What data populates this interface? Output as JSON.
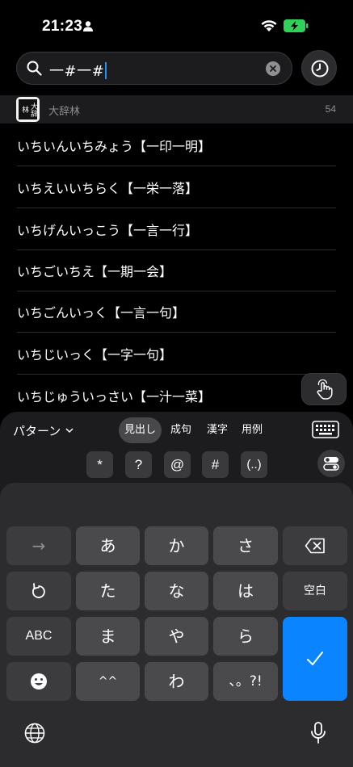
{
  "status": {
    "time": "21:23"
  },
  "search": {
    "query": "一#一#"
  },
  "dictionary": {
    "name": "大辞林",
    "logo_text": "大辞林",
    "count": "54"
  },
  "results": [
    {
      "text": "いちいんいちみょう【一印一明】"
    },
    {
      "text": "いちえいいちらく【一栄一落】"
    },
    {
      "text": "いちげんいっこう【一言一行】"
    },
    {
      "text": "いちごいちえ【一期一会】"
    },
    {
      "text": "いちごんいっく【一言一句】"
    },
    {
      "text": "いちじいっく【一字一句】"
    },
    {
      "text": "いちじゅういっさい【一汁一菜】"
    }
  ],
  "toolbar": {
    "pattern_label": "パターン",
    "segments": [
      "見出し",
      "成句",
      "漢字",
      "用例"
    ],
    "active_segment": "見出し",
    "symbols": [
      "*",
      "?",
      "@",
      "#",
      "(..)"
    ]
  },
  "keyboard": {
    "row1": [
      "→",
      "あ",
      "か",
      "さ"
    ],
    "row2": [
      "た",
      "な",
      "は",
      "空白"
    ],
    "row3": [
      "ABC",
      "ま",
      "や",
      "ら"
    ],
    "row4": [
      "^^",
      "わ",
      "、。?!"
    ],
    "colors": {
      "confirm": "#0a84ff",
      "caret": "#1e90ff",
      "battery": "#30d158"
    }
  }
}
